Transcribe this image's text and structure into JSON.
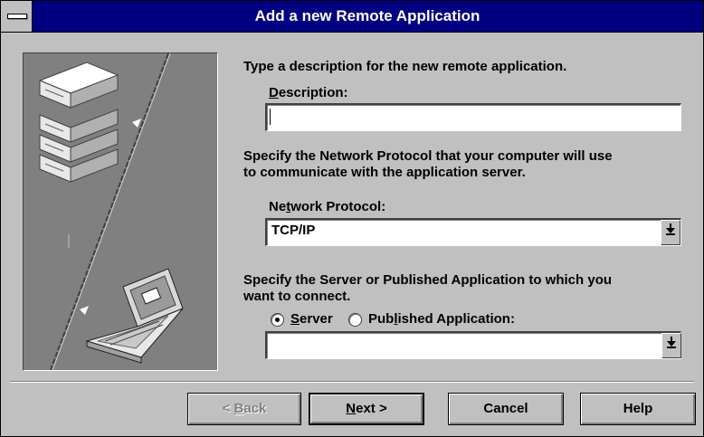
{
  "window": {
    "title": "Add a new Remote Application",
    "system_menu_icon": "system-menu-bar"
  },
  "illustration": {
    "server_icon": "server-stack-icon",
    "laptop_icon": "laptop-icon"
  },
  "description_section": {
    "prompt": "Type a description for the new remote application.",
    "label_hotkey": "D",
    "label_rest": "escription:",
    "value": ""
  },
  "protocol_section": {
    "prompt_line1": "Specify the Network Protocol that your computer will use",
    "prompt_line2": "to communicate with the application server.",
    "label_before": "Ne",
    "label_hotkey": "t",
    "label_after": "work Protocol:",
    "selected": "TCP/IP"
  },
  "server_section": {
    "prompt_line1": "Specify the Server or Published Application to which you",
    "prompt_line2": "want to connect.",
    "radio_server": {
      "hotkey": "S",
      "rest": "erver",
      "checked": true
    },
    "radio_published": {
      "before": "Pub",
      "hotkey": "l",
      "after": "ished Application:",
      "checked": false
    },
    "value": ""
  },
  "buttons": {
    "back": {
      "prefix": "< ",
      "hotkey": "B",
      "rest": "ack",
      "enabled": false
    },
    "next": {
      "hotkey": "N",
      "rest": "ext >",
      "default": true
    },
    "cancel": "Cancel",
    "help": "Help"
  },
  "colors": {
    "title_bar": "#000080",
    "face": "#c0c0c0",
    "art_bg": "#808080"
  }
}
